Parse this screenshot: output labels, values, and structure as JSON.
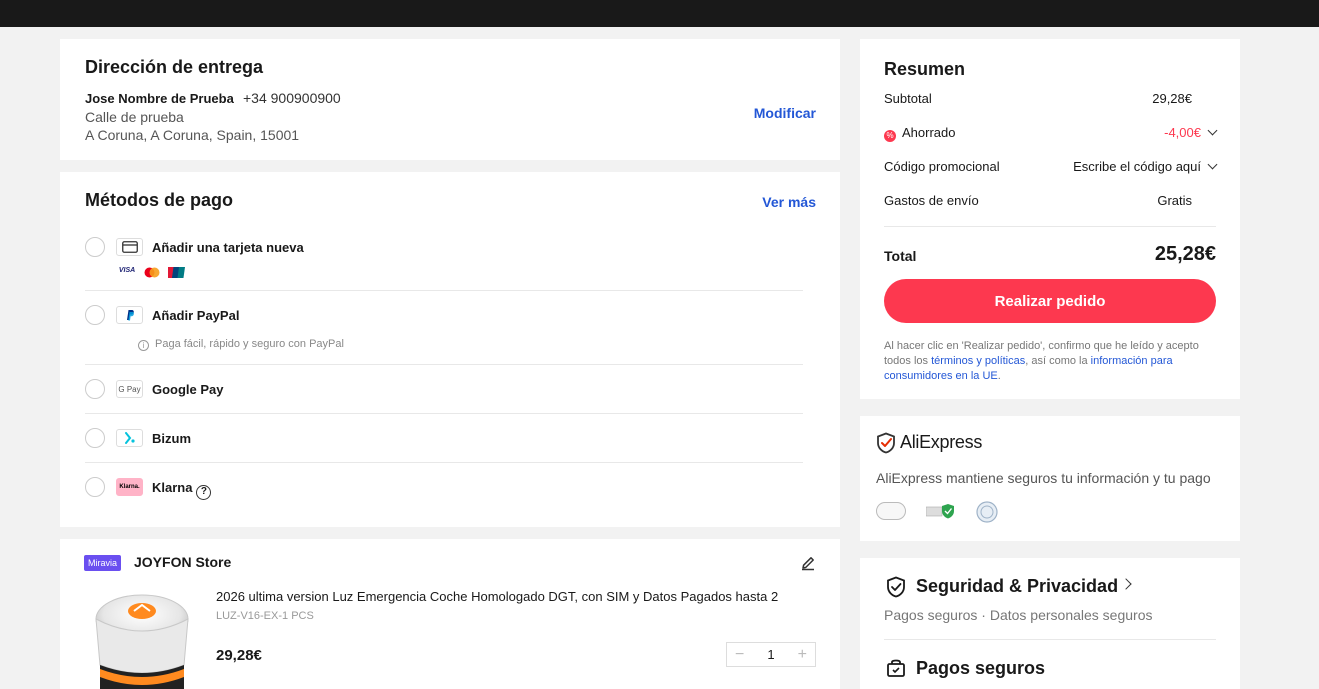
{
  "address": {
    "title": "Dirección de entrega",
    "name": "Jose Nombre de Prueba",
    "phone": "+34 900900900",
    "street": "Calle de prueba",
    "city": "A Coruna, A Coruna, Spain, 15001",
    "modify_label": "Modificar"
  },
  "payment": {
    "title": "Métodos de pago",
    "see_more_label": "Ver más",
    "methods": [
      {
        "label": "Añadir una tarjeta nueva",
        "icon": "credit-card-icon",
        "logos": [
          "VISA",
          "mastercard",
          "UnionPay"
        ]
      },
      {
        "label": "Añadir PayPal",
        "icon": "paypal-icon",
        "note": "Paga fácil, rápido y seguro con PayPal"
      },
      {
        "label": "Google Pay",
        "icon": "google-pay-icon",
        "icon_text": "G Pay"
      },
      {
        "label": "Bizum",
        "icon": "bizum-icon"
      },
      {
        "label": "Klarna",
        "icon": "klarna-icon",
        "icon_text": "Klarna."
      }
    ]
  },
  "store": {
    "badge": "Miravia",
    "name": "JOYFON Store",
    "product": {
      "title": "2026 ultima version Luz Emergencia Coche Homologado DGT, con SIM y Datos Pagados hasta 2",
      "sku": "LUZ-V16-EX-1 PCS",
      "price": "29,28€",
      "quantity": "1"
    }
  },
  "summary": {
    "title": "Resumen",
    "subtotal_label": "Subtotal",
    "subtotal_value": "29,28€",
    "saved_label": "Ahorrado",
    "saved_value": "-4,00€",
    "promo_label": "Código promocional",
    "promo_placeholder": "Escribe el código aquí",
    "shipping_label": "Gastos de envío",
    "shipping_value": "Gratis",
    "total_label": "Total",
    "total_value": "25,28€",
    "order_button": "Realizar pedido",
    "legal_part1": "Al hacer clic en 'Realizar pedido', confirmo que he leído y acepto todos los ",
    "legal_link1": "términos y políticas",
    "legal_part2": ", así como la ",
    "legal_link2": "información para consumidores en la UE",
    "legal_part3": "."
  },
  "trust": {
    "brand": "AliExpress",
    "description": "AliExpress mantiene seguros tu información y tu pago"
  },
  "security": {
    "title": "Seguridad & Privacidad",
    "subtitle": "Pagos seguros · Datos personales seguros",
    "title2": "Pagos seguros"
  },
  "colors": {
    "accent": "#fd384f",
    "link": "#2357d6",
    "topbar": "#191919",
    "miravia_badge": "#6a4ff0"
  }
}
